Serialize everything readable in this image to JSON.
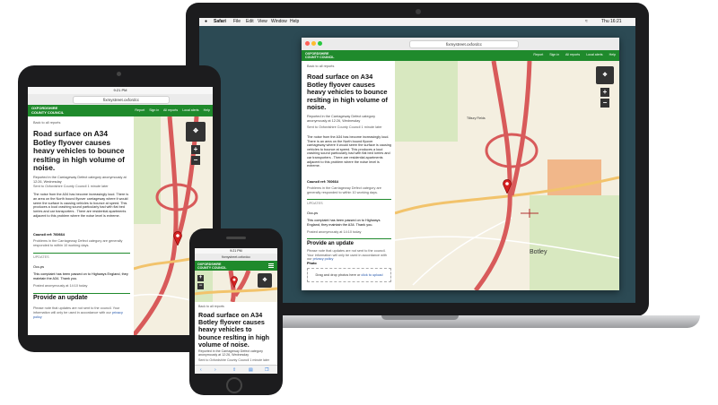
{
  "brand": {
    "line1": "OXFORDSHIRE",
    "line2": "COUNTY COUNCIL",
    "color": "#1f8a2c"
  },
  "browser": {
    "url": "fixmystreet.oxfordcc",
    "tablet_time": "9:21 PM",
    "phone_time": "9:21 PM",
    "laptop_time": "Thu 16:21"
  },
  "mac_menu": {
    "app": "Safari",
    "items": [
      "File",
      "Edit",
      "View",
      "Window",
      "Help"
    ]
  },
  "nav": {
    "report": "Report",
    "signin": "Sign in",
    "all_reports": "All reports",
    "local_alerts": "Local alerts",
    "help": "Help"
  },
  "report": {
    "back": "Back to all reports",
    "title": "Road surface on A34 Botley flyover causes heavy vehicles to bounce reslting in high volume of noise.",
    "reported": "Reported in the Carriageway Defect category anonymously at 12:26, Wednesday",
    "sent": "Sent to Oxfordshire County Council 1 minute later",
    "body": "The noise from the A34 has become increasingly loud. There is an area on the North bound flyover carriageway where it would seem the surface is causing vehicles to bounce at speed. This produces a loud crashing sound particularly bad with flat bed lorries and car transporters . There are residential apartments adjacent to this problem where the noise level is extreme.",
    "council_ref_label": "Council ref: 760664",
    "problems_note": "Problems in the Carriageway Defect category are generally responded to within 10 working days.",
    "updates_label": "UPDATES",
    "update_title": "Occ-ps",
    "update_text": "This complaint has been passed on to Highways England, they maintain the A34. Thank you.",
    "update_posted": "Posted anonymously at 14:10 today",
    "provide_update": "Provide an update",
    "update_note": "Please note that updates are not sent to the council. Your information will only be used in accordance with our",
    "privacy": "privacy policy",
    "photo_label": "Photo",
    "drop_text": "Drag and drop photos here or",
    "click_upload": "click to upload"
  },
  "map": {
    "place_botley": "Botley",
    "place_tilbury": "Tilbury Fields"
  }
}
